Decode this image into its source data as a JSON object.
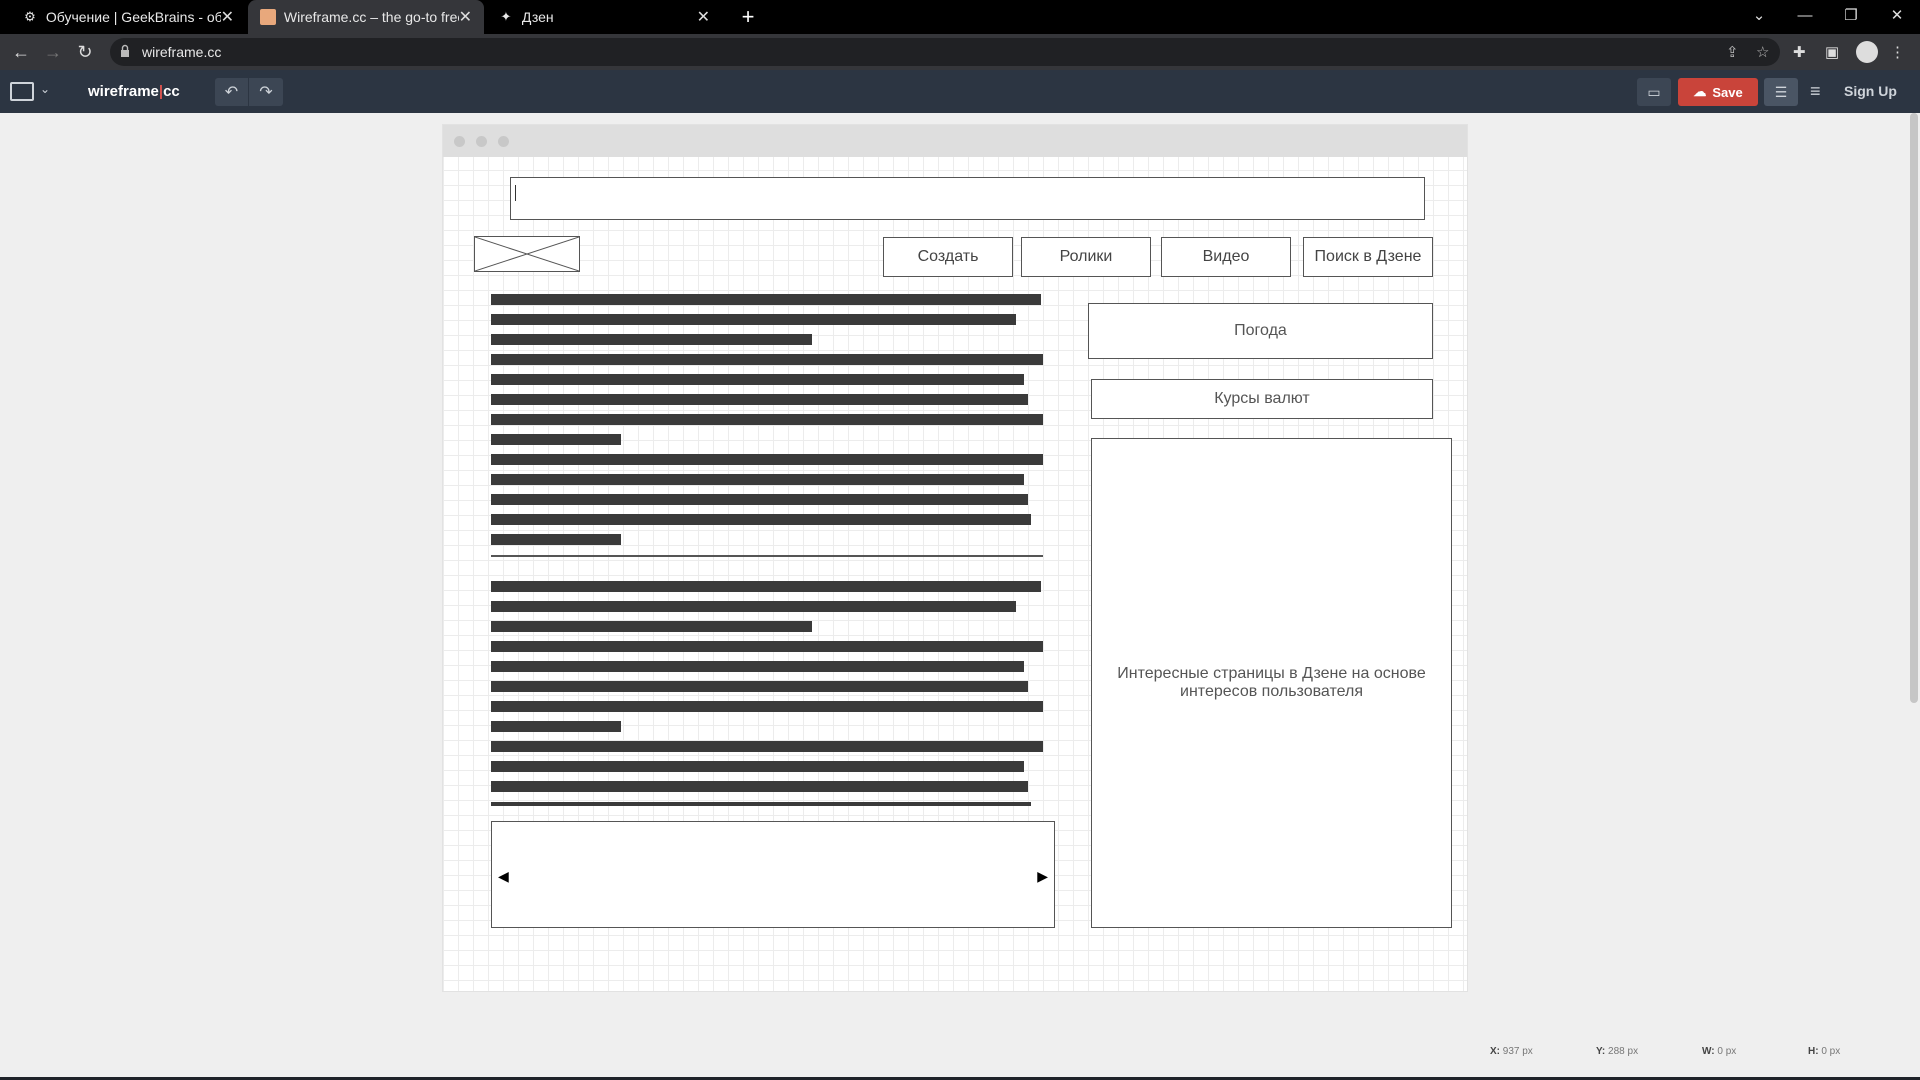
{
  "browser": {
    "tabs": [
      {
        "title": "Обучение | GeekBrains - образо",
        "active": false
      },
      {
        "title": "Wireframe.cc – the go-to free, on",
        "active": true
      },
      {
        "title": "Дзен",
        "active": false
      }
    ],
    "url": "wireframe.cc"
  },
  "toolbar": {
    "logo_left": "wireframe",
    "logo_sep": "|",
    "logo_right": "cc",
    "save_label": "Save",
    "signup_label": "Sign Up"
  },
  "wireframe": {
    "nav_buttons": [
      "Создать",
      "Ролики",
      "Видео",
      "Поиск в Дзене"
    ],
    "weather": "Погода",
    "currency": "Курсы валют",
    "recommendations": "Интересные страницы в Дзене на основе интересов пользователя"
  },
  "status": {
    "x_label": "X:",
    "x_value": "937 px",
    "y_label": "Y:",
    "y_value": "288 px",
    "w_label": "W:",
    "w_value": "0 px",
    "h_label": "H:",
    "h_value": "0 px"
  },
  "colors": {
    "toolbar_bg": "#2c3542",
    "save_bg": "#c9443a",
    "text_block": "#3a3a3a"
  }
}
